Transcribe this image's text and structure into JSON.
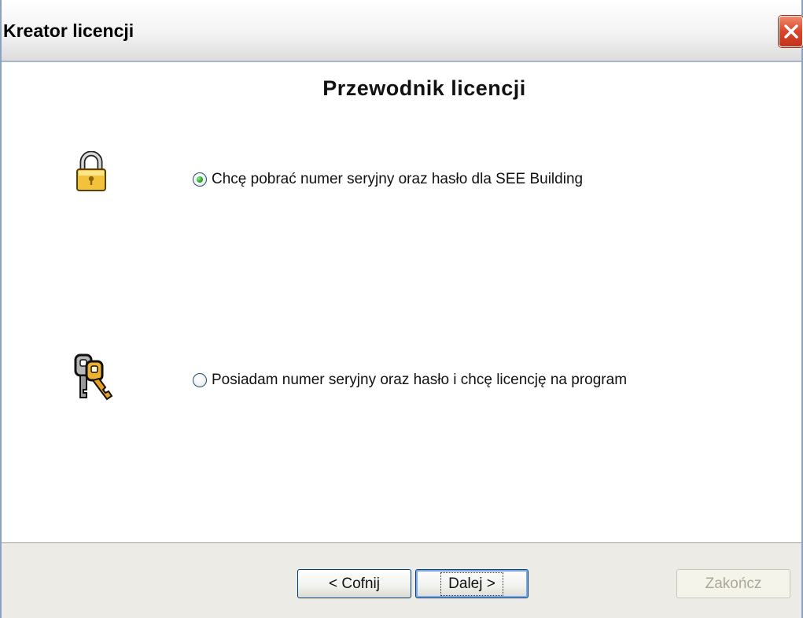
{
  "window": {
    "title": "Kreator licencji"
  },
  "heading": "Przewodnik licencji",
  "options": [
    {
      "label": "Chcę pobrać numer seryjny oraz hasło dla SEE Building",
      "checked": true,
      "icon": "lock-icon"
    },
    {
      "label": "Posiadam numer seryjny oraz hasło i chcę licencję na program",
      "checked": false,
      "icon": "keys-icon"
    }
  ],
  "buttons": {
    "back": "< Cofnij",
    "next": "Dalej >",
    "finish": "Zakończ"
  },
  "colors": {
    "close": "#d8452a",
    "radio_dot": "#2ea52b",
    "accent_border": "#003c74"
  }
}
